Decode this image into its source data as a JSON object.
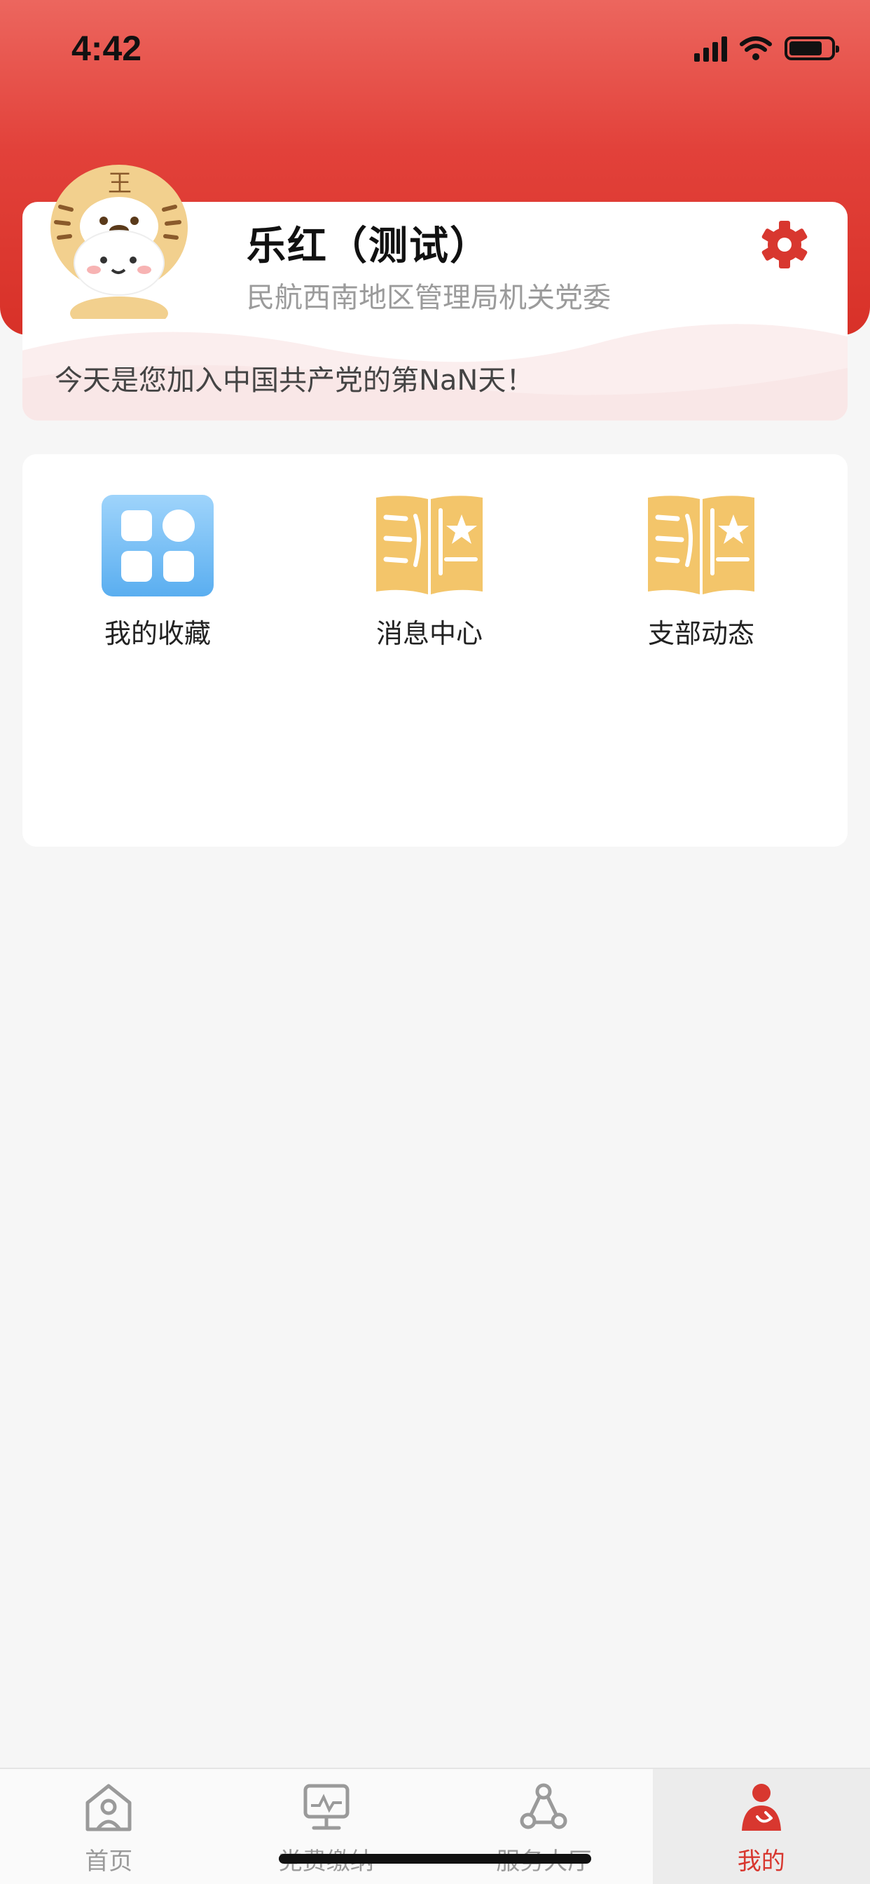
{
  "status_bar": {
    "time": "4:42"
  },
  "profile": {
    "name": "乐红（测试）",
    "org": "民航西南地区管理局机关党委",
    "join_message": "今天是您加入中国共产党的第NaN天！"
  },
  "menu": {
    "items": [
      {
        "label": "我的收藏",
        "icon": "grid-icon"
      },
      {
        "label": "消息中心",
        "icon": "book-icon"
      },
      {
        "label": "支部动态",
        "icon": "book-icon"
      }
    ]
  },
  "tab_bar": {
    "items": [
      {
        "label": "首页",
        "icon": "home-icon"
      },
      {
        "label": "党费缴纳",
        "icon": "monitor-icon"
      },
      {
        "label": "服务大厅",
        "icon": "network-icon"
      },
      {
        "label": "我的",
        "icon": "person-icon"
      }
    ],
    "active_index": 3
  },
  "colors": {
    "brand_red": "#d8372f",
    "header_red": "#e2413a",
    "icon_gold": "#f3c56a",
    "icon_blue": "#5db3f0"
  }
}
